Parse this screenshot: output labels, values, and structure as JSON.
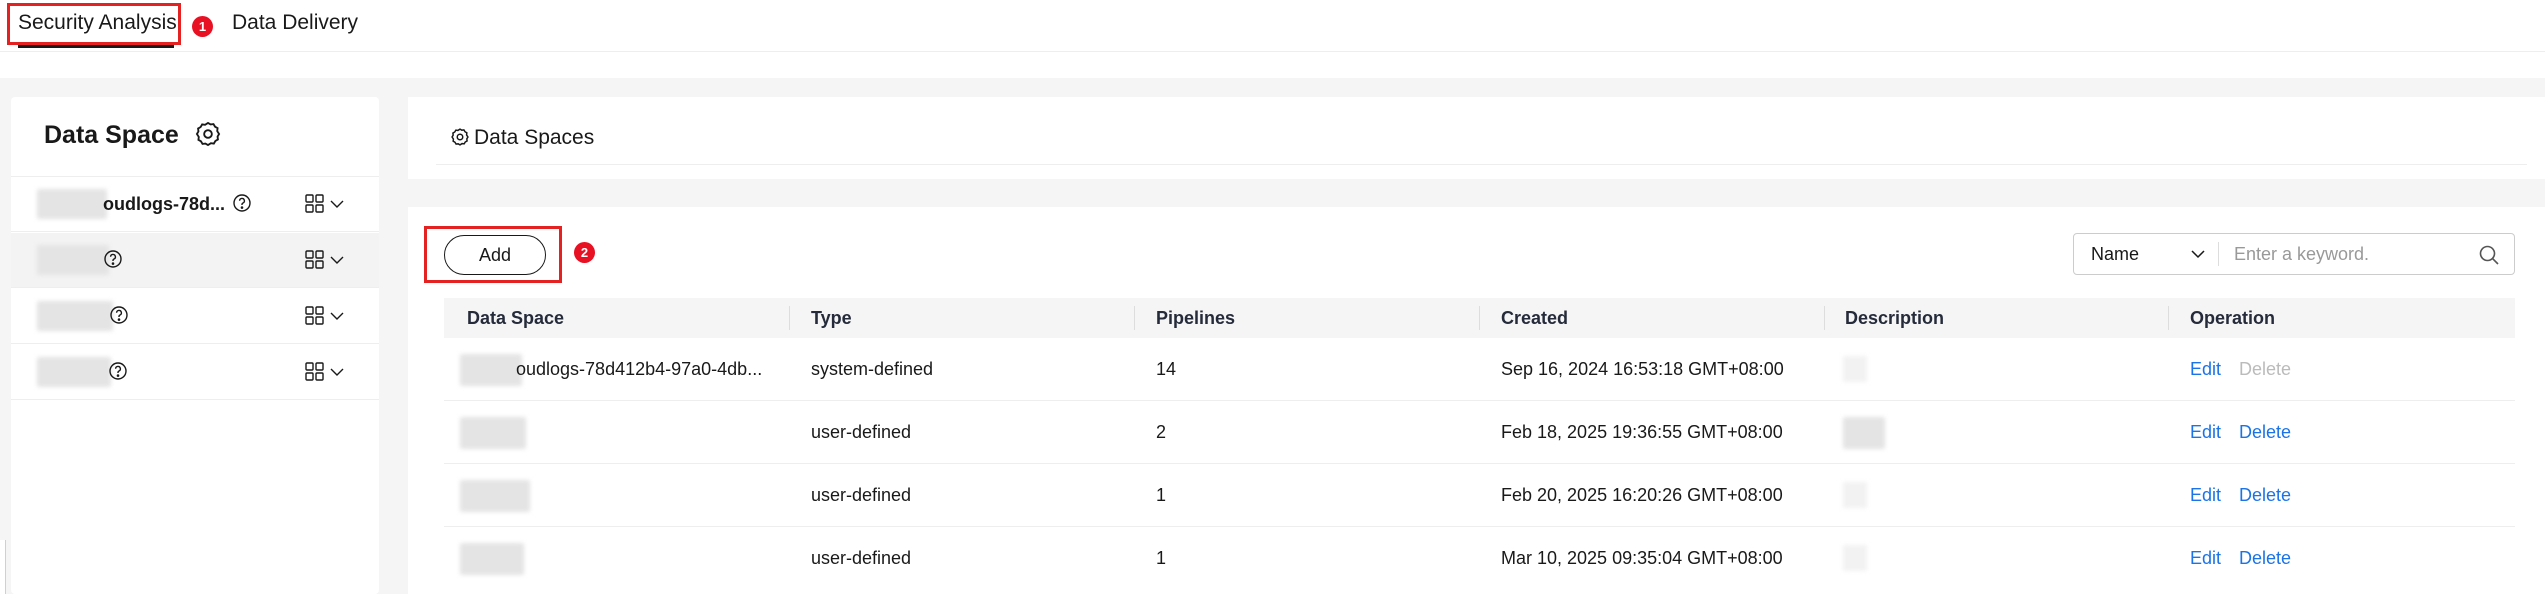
{
  "tabs": {
    "security_analysis": "Security Analysis",
    "data_delivery": "Data Delivery",
    "marker_1": "1",
    "marker_2": "2"
  },
  "sidebar": {
    "title": "Data Space",
    "items": [
      {
        "label": "oudlogs-78d...",
        "icons": [
          "help-icon",
          "grid-icon",
          "chevron-down-icon"
        ]
      },
      {
        "label": "",
        "icons": [
          "help-icon",
          "grid-icon",
          "chevron-down-icon"
        ]
      },
      {
        "label": "",
        "icons": [
          "help-icon",
          "grid-icon",
          "chevron-down-icon"
        ]
      },
      {
        "label": "",
        "icons": [
          "help-icon",
          "grid-icon",
          "chevron-down-icon"
        ]
      }
    ]
  },
  "main": {
    "title": "Data Spaces",
    "add_label": "Add",
    "search": {
      "field": "Name",
      "placeholder": "Enter a keyword."
    },
    "table": {
      "columns": [
        "Data Space",
        "Type",
        "Pipelines",
        "Created",
        "Description",
        "Operation"
      ],
      "rows": [
        {
          "data_space": "oudlogs-78d412b4-97a0-4db...",
          "type": "system-defined",
          "pipelines": "14",
          "created": "Sep 16, 2024 16:53:18 GMT+08:00",
          "edit": "Edit",
          "delete": "Delete"
        },
        {
          "data_space": "",
          "type": "user-defined",
          "pipelines": "2",
          "created": "Feb 18, 2025 19:36:55 GMT+08:00",
          "edit": "Edit",
          "delete": "Delete"
        },
        {
          "data_space": "",
          "type": "user-defined",
          "pipelines": "1",
          "created": "Feb 20, 2025 16:20:26 GMT+08:00",
          "edit": "Edit",
          "delete": "Delete"
        },
        {
          "data_space": "",
          "type": "user-defined",
          "pipelines": "1",
          "created": "Mar 10, 2025 09:35:04 GMT+08:00",
          "edit": "Edit",
          "delete": "Delete"
        }
      ]
    }
  },
  "colors": {
    "highlight": "#e52222",
    "marker": "#e81123",
    "link": "#1a73e8",
    "disabled": "#bbbbbb"
  }
}
